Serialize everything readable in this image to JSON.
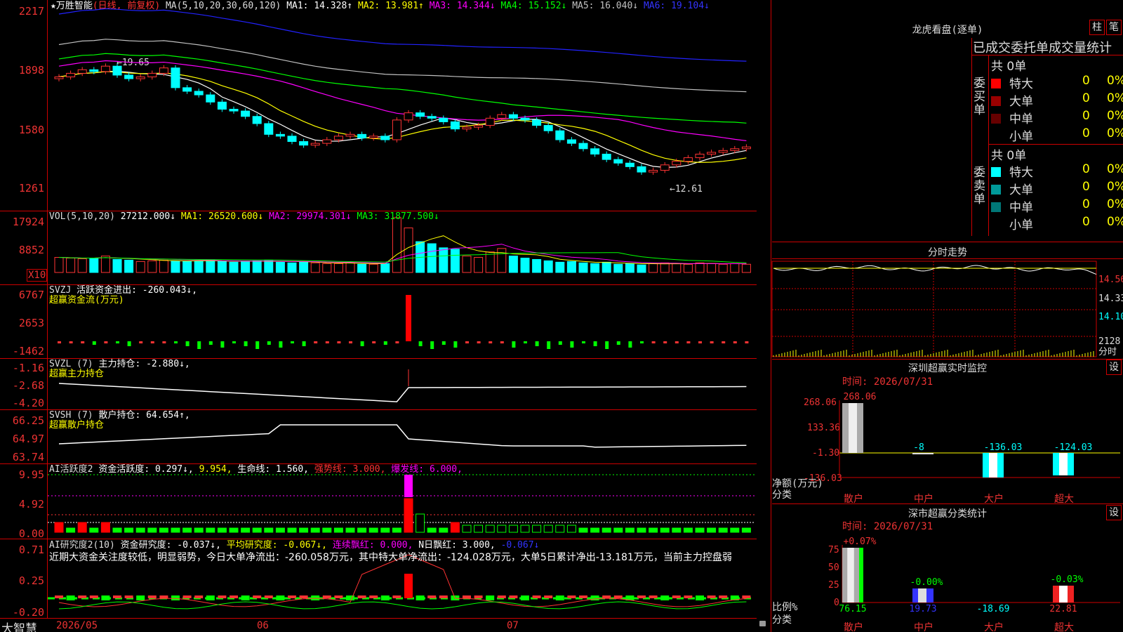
{
  "app": {
    "brand": "大智慧"
  },
  "chart": {
    "title_star": "★",
    "stock_name": "万胜智能",
    "period": "(日线, 前复权)",
    "ma_header": "MA(5,10,20,30,60,120)",
    "ma_values": [
      {
        "label": "MA1: 14.328↑",
        "color": "#ffffff"
      },
      {
        "label": "MA2: 13.981↑",
        "color": "#ffff00"
      },
      {
        "label": "MA3: 14.344↓",
        "color": "#ff00ff"
      },
      {
        "label": "MA4: 15.152↓",
        "color": "#00ff00"
      },
      {
        "label": "MA5: 16.040↓",
        "color": "#c0c0c0"
      },
      {
        "label": "MA6: 19.104↓",
        "color": "#0000ff"
      }
    ],
    "price_axis": [
      "2217",
      "1898",
      "1580",
      "1261"
    ],
    "high_marker": "←19.65",
    "low_marker": "←12.61",
    "date_axis": [
      "2026/05",
      "06",
      "07"
    ],
    "close_prices": [
      18.3,
      18.5,
      18.7,
      18.6,
      18.9,
      18.4,
      18.2,
      18.3,
      18.5,
      18.8,
      17.7,
      17.5,
      17.3,
      16.9,
      16.5,
      16.4,
      16.1,
      15.7,
      15.1,
      15.0,
      14.7,
      14.5,
      14.6,
      14.8,
      15.0,
      15.1,
      14.9,
      15.0,
      14.8,
      15.9,
      16.3,
      16.1,
      16.0,
      15.8,
      15.4,
      15.5,
      15.6,
      16.0,
      16.2,
      16.0,
      15.9,
      15.6,
      15.3,
      14.8,
      14.6,
      14.3,
      14.0,
      13.7,
      13.5,
      13.3,
      13.0,
      13.1,
      13.4,
      13.6,
      13.8,
      14.0,
      14.1,
      14.2,
      14.3,
      14.4
    ]
  },
  "volume": {
    "header": "VOL(5,10,20)",
    "value": "27212.000↓",
    "ma1": "MA1: 26520.600↓",
    "ma2": "MA2: 29974.301↓",
    "ma3": "MA3: 31877.500↓",
    "axis": [
      "17924",
      "8852"
    ],
    "multiplier": "X10",
    "bars": [
      2.2,
      2.1,
      2.0,
      2.1,
      2.4,
      1.9,
      1.8,
      1.6,
      1.7,
      1.8,
      1.7,
      1.6,
      1.7,
      1.8,
      1.6,
      1.5,
      1.6,
      1.7,
      1.8,
      1.5,
      1.4,
      1.5,
      1.4,
      1.3,
      1.3,
      1.4,
      1.2,
      1.2,
      1.3,
      8.0,
      6.5,
      4.5,
      4.2,
      3.6,
      3.4,
      2.4,
      2.2,
      3.0,
      3.5,
      2.4,
      2.1,
      1.9,
      1.7,
      1.5,
      1.6,
      1.4,
      1.3,
      1.5,
      1.2,
      1.3,
      1.1,
      1.3,
      1.4,
      1.3,
      1.2,
      1.4,
      1.3,
      1.2,
      1.3,
      1.2
    ]
  },
  "svzj": {
    "header": "SVZJ",
    "label": "活跃资金进出: -260.043↓,",
    "sub": "超赢资金流(万元)",
    "axis": [
      "6767",
      "2653",
      "-1462"
    ]
  },
  "svzl": {
    "header": "SVZL (7)",
    "label": "主力持仓: -2.880↓,",
    "sub": "超赢主力持仓",
    "axis": [
      "-1.16",
      "-2.68",
      "-4.20"
    ]
  },
  "svsh": {
    "header": "SVSH (7)",
    "label": "散户持仓: 64.654↑,",
    "sub": "超赢散户持仓",
    "axis": [
      "66.25",
      "64.97",
      "63.74"
    ]
  },
  "ai_active": {
    "header": "AI活跃度2",
    "label": "资金活跃度: 0.297↓,",
    "v2": "9.954,",
    "life": "生命线: 1.560,",
    "strong": "强势线: 3.000,",
    "burst": "爆发线: 6.000,",
    "axis": [
      "9.95",
      "4.92",
      "0.00"
    ]
  },
  "ai_research": {
    "header": "AI研究度2(10)",
    "label": "资金研究度: -0.037↓,",
    "avg": "平均研究度: -0.067↓,",
    "red": "连续飘红: 0.000,",
    "nred": "N日飘红: 3.000,",
    "last": "-0.067↓",
    "comment": "近期大资金关注度较低，明显弱势，今日大单净流出：-260.058万元，其中特大单净流出：-124.028万元，大单5日累计净出-13.181万元，当前主力控盘弱",
    "axis": [
      "0.71",
      "0.25",
      "-0.20"
    ]
  },
  "dragon": {
    "title": "龙虎看盘(逐单)",
    "btn_zhu": "柱",
    "btn_bi": "笔",
    "tabs": "已成交委托单成交量统计",
    "buy_side": "委买单",
    "sell_side": "委卖单",
    "buy_total": "共 0单",
    "sell_total": "共 0单",
    "buy_rows": [
      {
        "label": "特大",
        "count": "0",
        "pct": "0%",
        "color": "#ff0000"
      },
      {
        "label": "大单",
        "count": "0",
        "pct": "0%",
        "color": "#990000"
      },
      {
        "label": "中单",
        "count": "0",
        "pct": "0%",
        "color": "#660000"
      },
      {
        "label": "小单",
        "count": "0",
        "pct": "0%",
        "color": "#000000"
      }
    ],
    "sell_rows": [
      {
        "label": "特大",
        "count": "0",
        "pct": "0%",
        "color": "#00ffff"
      },
      {
        "label": "大单",
        "count": "0",
        "pct": "0%",
        "color": "#009999"
      },
      {
        "label": "中单",
        "count": "0",
        "pct": "0%",
        "color": "#007777"
      },
      {
        "label": "小单",
        "count": "0",
        "pct": "0%",
        "color": "#000000"
      }
    ]
  },
  "intraday": {
    "title": "分时走势",
    "axis": [
      "14.56",
      "14.33",
      "14.10",
      "2128"
    ],
    "unit": "分时"
  },
  "sz_monitor": {
    "title": "深圳超赢实时监控",
    "btn": "设",
    "time": "时间: 2026/07/31",
    "axis": [
      "268.06",
      "133.36",
      "-1.30",
      "-136.03"
    ],
    "axis_label": "净额(万元)",
    "cat_label": "分类",
    "categories": [
      "散户",
      "中户",
      "大户",
      "超大"
    ],
    "values": [
      "268.06",
      "-8",
      "-136.03",
      "-124.03"
    ]
  },
  "sz_class": {
    "title": "深市超赢分类统计",
    "btn": "设",
    "time": "时间: 2026/07/31",
    "axis": [
      "75",
      "50",
      "25",
      "0"
    ],
    "axis_label": "比例%",
    "cat_label": "分类",
    "categories": [
      "散户",
      "中户",
      "大户",
      "超大"
    ],
    "top_values": [
      "+0.07%",
      "-0.00%",
      "",
      "-0.03%"
    ],
    "bottom_values": [
      "76.15",
      "19.73",
      "-18.69",
      "22.81"
    ]
  }
}
